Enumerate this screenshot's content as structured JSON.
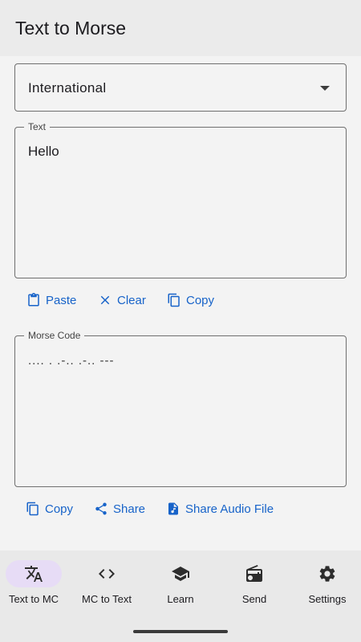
{
  "app_bar": {
    "title": "Text to Morse"
  },
  "dropdown": {
    "selected": "International"
  },
  "text_field": {
    "label": "Text",
    "value": "Hello"
  },
  "text_actions": {
    "paste": "Paste",
    "clear": "Clear",
    "copy": "Copy"
  },
  "morse_field": {
    "label": "Morse Code",
    "value": ".... . .-.. .-.. ---"
  },
  "morse_actions": {
    "copy": "Copy",
    "share": "Share",
    "share_audio": "Share Audio File"
  },
  "bottom_nav": {
    "items": [
      {
        "label": "Text to MC",
        "icon": "translate-icon",
        "active": true
      },
      {
        "label": "MC to Text",
        "icon": "code-icon",
        "active": false
      },
      {
        "label": "Learn",
        "icon": "school-icon",
        "active": false
      },
      {
        "label": "Send",
        "icon": "radio-icon",
        "active": false
      },
      {
        "label": "Settings",
        "icon": "gear-icon",
        "active": false
      }
    ]
  },
  "colors": {
    "accent": "#1763c9",
    "active_pill": "#e7dcf6"
  }
}
